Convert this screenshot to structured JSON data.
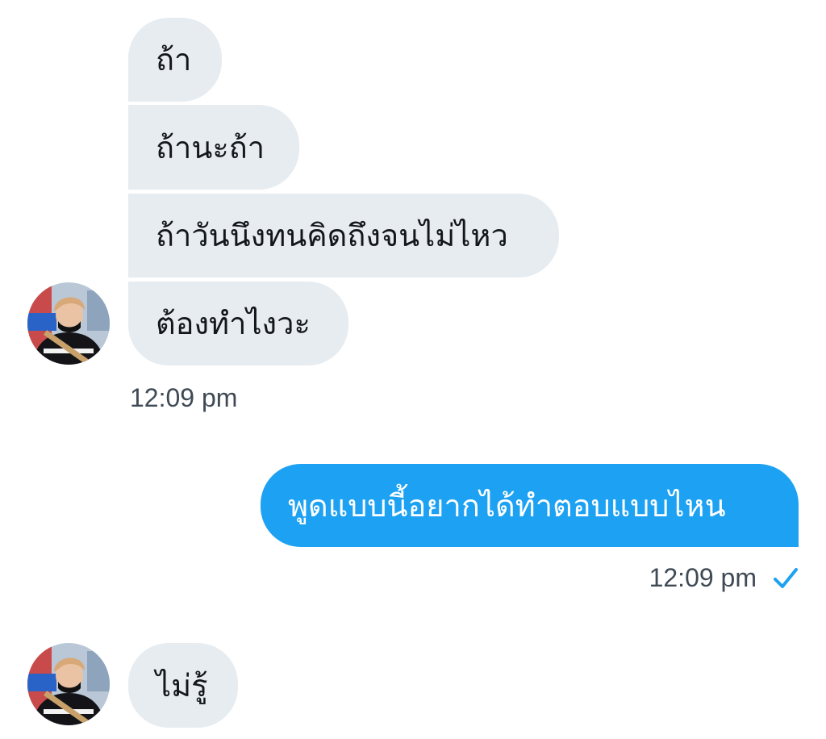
{
  "conversation": {
    "incoming_group_1": [
      "ถ้า",
      "ถ้านะถ้า",
      "ถ้าวันนึงทนคิดถึงจนไม่ไหว",
      "ต้องทำไงวะ"
    ],
    "incoming_group_1_time": "12:09 pm",
    "outgoing_message": "พูดแบบนี้อยากได้ทำตอบแบบไหน",
    "outgoing_time": "12:09 pm",
    "incoming_group_2": [
      "ไม่รู้"
    ]
  },
  "colors": {
    "incoming_bubble": "#e6ecf0",
    "outgoing_bubble": "#1da1f2",
    "timestamp_text": "#3f4a55",
    "read_check": "#1da1f2"
  },
  "icons": {
    "sent_status": "checkmark-icon",
    "contact_avatar": "avatar"
  }
}
